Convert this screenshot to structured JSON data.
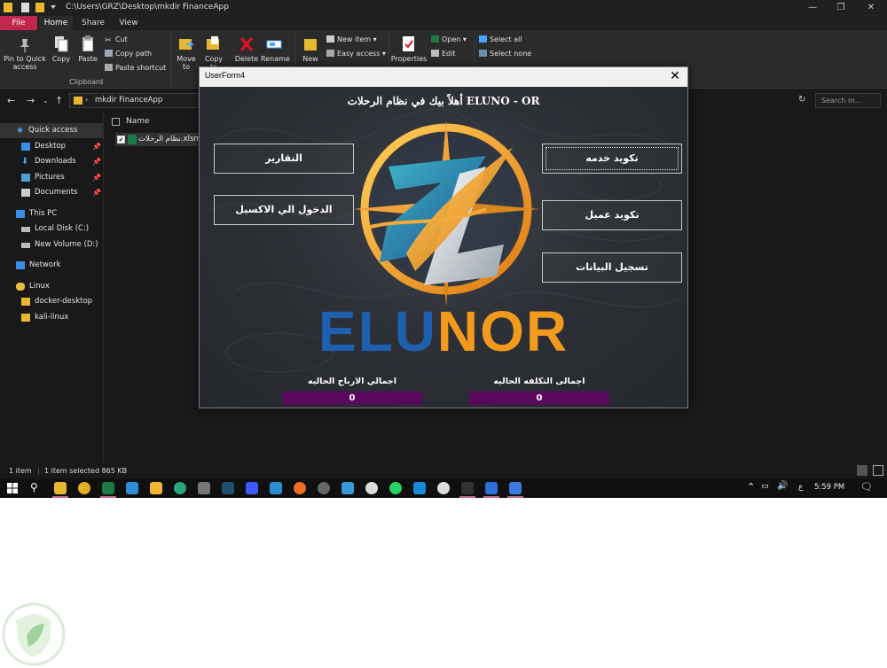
{
  "explorer": {
    "window_path": "C:\\Users\\GRZ\\Desktop\\mkdir FinanceApp",
    "tabs": [
      "File",
      "Home",
      "Share",
      "View"
    ],
    "ribbon": {
      "pin": "Pin to Quick access",
      "copy": "Copy",
      "paste": "Paste",
      "cut": "Cut",
      "copy_path": "Copy path",
      "paste_shortcut": "Paste shortcut",
      "clipboard_group": "Clipboard",
      "move_to": "Move to",
      "copy_to": "Copy to",
      "delete": "Delete",
      "rename": "Rename",
      "new": "New",
      "new_item": "New item",
      "easy_access": "Easy access",
      "properties": "Properties",
      "open": "Open",
      "edit": "Edit",
      "select_all": "Select all",
      "select_none": "Select none"
    },
    "address": "mkdir FinanceApp",
    "search_placeholder": "Search m...",
    "nav": {
      "quick_access": "Quick access",
      "desktop": "Desktop",
      "downloads": "Downloads",
      "pictures": "Pictures",
      "documents": "Documents",
      "this_pc": "This PC",
      "local_disk": "Local Disk (C:)",
      "new_volume": "New Volume (D:)",
      "network": "Network",
      "linux": "Linux",
      "docker": "docker-desktop",
      "kali": "kali-linux"
    },
    "column_name": "Name",
    "file_name": "نظام الرحلات.xlsm",
    "status": {
      "count": "1 item",
      "selected": "1 item selected  865 KB"
    }
  },
  "taskbar": {
    "time": "5:59 PM",
    "lang": "ع"
  },
  "userform": {
    "title": "UserForm4",
    "close": "✕",
    "welcome": "أهلاً بيك في نظام الرحلات ELUNO - OR",
    "buttons": {
      "reports": "التقارير",
      "excel_login": "الدخول الي الاكسيل",
      "service_code": "تكويد خدمه",
      "client_code": "تكويد عميل",
      "data_entry": "تسجيل البيانات"
    },
    "brand_left": "ELU",
    "brand_right": "NOR",
    "profit_label": "اجمالي الارباح الحاليه",
    "profit_value": "0",
    "cost_label": "اجمالى التكلفه الحاليه",
    "cost_value": "0",
    "colors": {
      "brand_blue": "#1f5fb0",
      "brand_orange": "#f29a1e",
      "total_bg": "#5a0a5c"
    }
  }
}
